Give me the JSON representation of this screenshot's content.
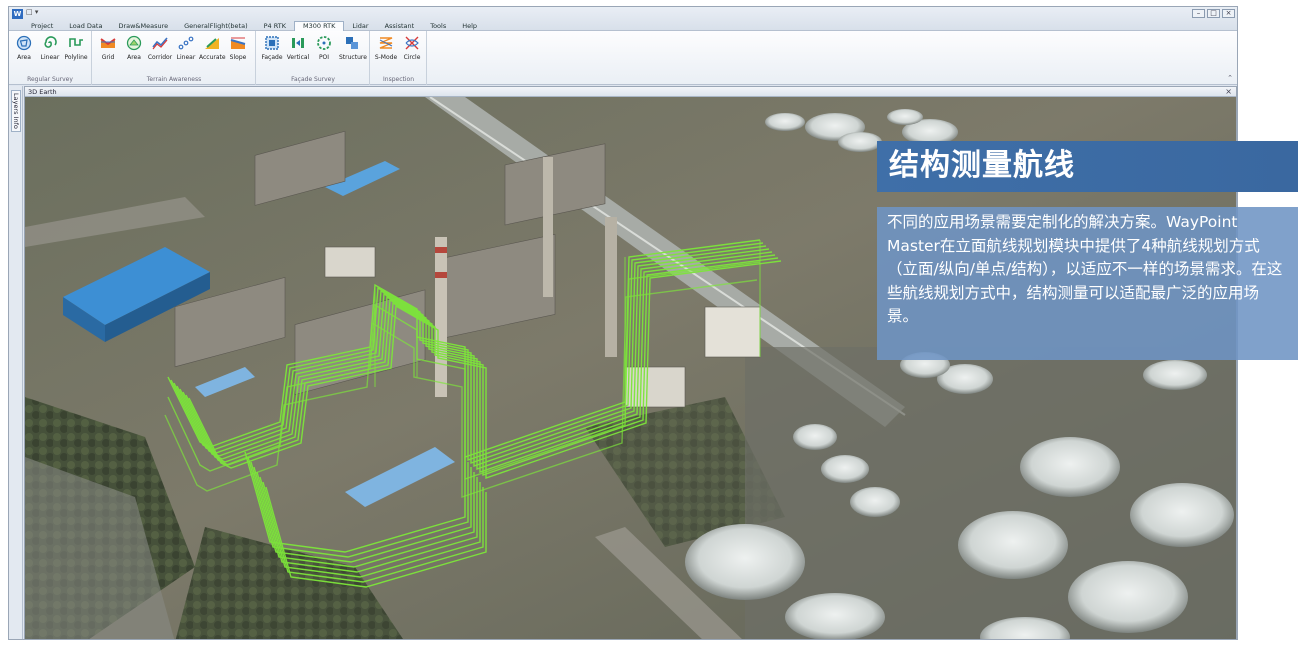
{
  "app": {
    "logo_letter": "W",
    "quick_access": "□ ▾",
    "window_controls": [
      "–",
      "□",
      "×"
    ]
  },
  "menu": {
    "items": [
      "Project",
      "Load Data",
      "Draw&Measure",
      "GeneralFlight(beta)",
      "P4 RTK",
      "M300 RTK",
      "Lidar",
      "Assistant",
      "Tools",
      "Help"
    ],
    "active": "M300 RTK"
  },
  "ribbon": {
    "groups": [
      {
        "label": "Regular Survey",
        "buttons": [
          {
            "label": "Area",
            "icon": "area-polygon-icon"
          },
          {
            "label": "Linear",
            "icon": "linear-spiral-icon"
          },
          {
            "label": "Polyline",
            "icon": "polyline-icon"
          }
        ]
      },
      {
        "label": "Terrain Awareness",
        "buttons": [
          {
            "label": "Grid",
            "icon": "grid-terrain-icon"
          },
          {
            "label": "Area",
            "icon": "area-terrain-icon"
          },
          {
            "label": "Corridor",
            "icon": "corridor-icon"
          },
          {
            "label": "Linear",
            "icon": "linear-terrain-icon"
          },
          {
            "label": "Accurate",
            "icon": "accurate-icon"
          },
          {
            "label": "Slope",
            "icon": "slope-icon"
          }
        ]
      },
      {
        "label": "Façade Survey",
        "buttons": [
          {
            "label": "Façade",
            "icon": "facade-icon"
          },
          {
            "label": "Vertical",
            "icon": "vertical-icon"
          },
          {
            "label": "POI",
            "icon": "poi-icon"
          },
          {
            "label": "Structure",
            "icon": "structure-icon"
          }
        ]
      },
      {
        "label": "Inspection",
        "buttons": [
          {
            "label": "S-Mode",
            "icon": "s-mode-icon"
          },
          {
            "label": "Circle",
            "icon": "circle-mode-icon"
          }
        ]
      }
    ]
  },
  "side_panel": {
    "label": "Layers Info"
  },
  "viewport": {
    "title": "3D Earth",
    "close": "×"
  },
  "overlay": {
    "title": "结构测量航线",
    "description": "不同的应用场景需要定制化的解决方案。WayPoint Master在立面航线规划模块中提供了4种航线规划方式（立面/纵向/单点/结构），以适应不一样的场景需求。在这些航线规划方式中，结构测量可以适配最广泛的应用场景。"
  },
  "colors": {
    "flight_path": "#7de63a",
    "banner_blue": "#3f6fa8",
    "panel_blue": "#6e94c4"
  }
}
